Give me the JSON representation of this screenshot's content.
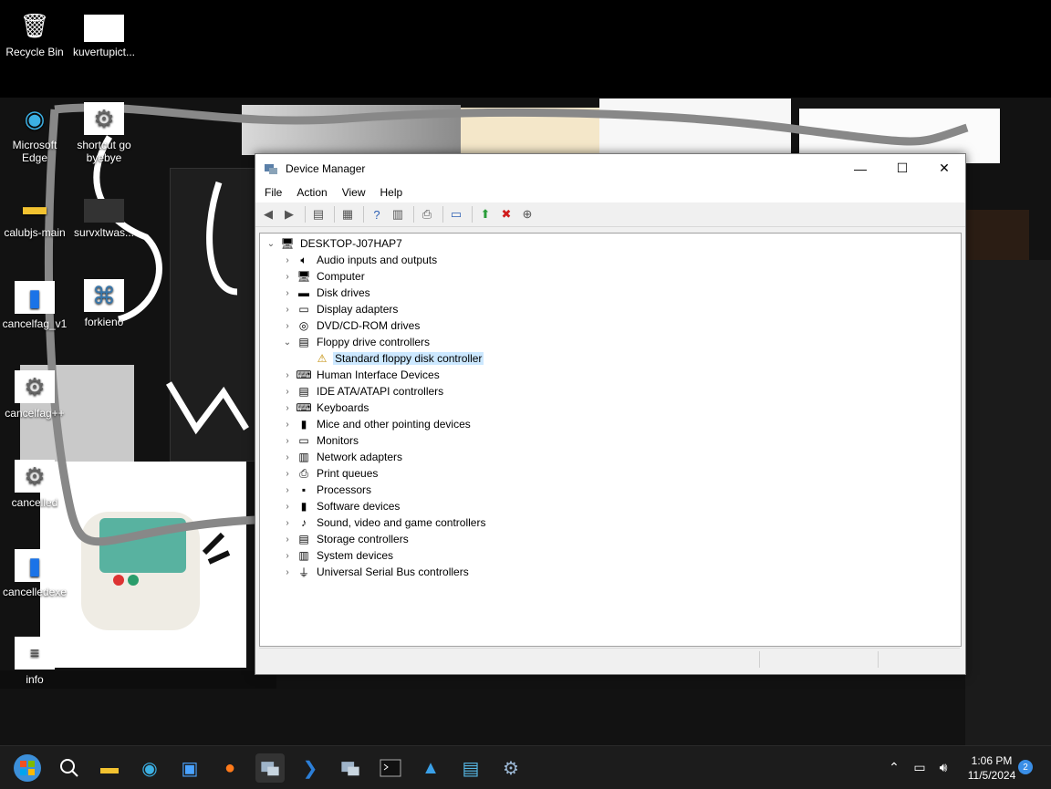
{
  "desktop": {
    "icons": [
      {
        "label": "Recycle Bin",
        "icon": "recycle-bin-icon"
      },
      {
        "label": "kuvertupict...",
        "icon": "image-file-icon"
      },
      {
        "label": "Microsoft Edge",
        "icon": "edge-icon"
      },
      {
        "label": "shortcut go byebye",
        "icon": "settings-gear-icon"
      },
      {
        "label": "calubjs-main",
        "icon": "folder-icon"
      },
      {
        "label": "survxltwas...",
        "icon": "image-file-icon"
      },
      {
        "label": "cancelfag_v1",
        "icon": "document-icon"
      },
      {
        "label": "forkieno",
        "icon": "python-file-icon"
      },
      {
        "label": "cancelfag++",
        "icon": "settings-gear-icon"
      },
      {
        "label": "cancelled",
        "icon": "settings-gear-icon"
      },
      {
        "label": "cancelledexe",
        "icon": "document-icon"
      },
      {
        "label": "info",
        "icon": "text-file-icon"
      }
    ]
  },
  "window": {
    "title": "Device Manager",
    "menu": [
      "File",
      "Action",
      "View",
      "Help"
    ],
    "controls": {
      "minimize": "—",
      "maximize": "☐",
      "close": "✕"
    },
    "tree": {
      "root": "DESKTOP-J07HAP7",
      "categories": [
        {
          "label": "Audio inputs and outputs",
          "icon": "speaker-icon",
          "expanded": false
        },
        {
          "label": "Computer",
          "icon": "computer-icon",
          "expanded": false
        },
        {
          "label": "Disk drives",
          "icon": "disk-drive-icon",
          "expanded": false
        },
        {
          "label": "Display adapters",
          "icon": "display-adapter-icon",
          "expanded": false
        },
        {
          "label": "DVD/CD-ROM drives",
          "icon": "dvd-drive-icon",
          "expanded": false
        },
        {
          "label": "Floppy drive controllers",
          "icon": "floppy-controller-icon",
          "expanded": true,
          "children": [
            {
              "label": "Standard floppy disk controller",
              "icon": "warning-device-icon",
              "selected": true
            }
          ]
        },
        {
          "label": "Human Interface Devices",
          "icon": "hid-icon",
          "expanded": false
        },
        {
          "label": "IDE ATA/ATAPI controllers",
          "icon": "ide-controller-icon",
          "expanded": false
        },
        {
          "label": "Keyboards",
          "icon": "keyboard-icon",
          "expanded": false
        },
        {
          "label": "Mice and other pointing devices",
          "icon": "mouse-icon",
          "expanded": false
        },
        {
          "label": "Monitors",
          "icon": "monitor-icon",
          "expanded": false
        },
        {
          "label": "Network adapters",
          "icon": "network-adapter-icon",
          "expanded": false
        },
        {
          "label": "Print queues",
          "icon": "printer-icon",
          "expanded": false
        },
        {
          "label": "Processors",
          "icon": "processor-icon",
          "expanded": false
        },
        {
          "label": "Software devices",
          "icon": "software-device-icon",
          "expanded": false
        },
        {
          "label": "Sound, video and game controllers",
          "icon": "sound-controller-icon",
          "expanded": false
        },
        {
          "label": "Storage controllers",
          "icon": "storage-controller-icon",
          "expanded": false
        },
        {
          "label": "System devices",
          "icon": "system-device-icon",
          "expanded": false
        },
        {
          "label": "Universal Serial Bus controllers",
          "icon": "usb-icon",
          "expanded": false
        }
      ]
    }
  },
  "taskbar": {
    "items": [
      "start-icon",
      "search-icon",
      "file-explorer-icon",
      "edge-icon",
      "store-icon",
      "firefox-icon",
      "device-manager-icon",
      "powershell-icon",
      "device-manager-icon",
      "terminal-icon",
      "photos-icon",
      "notepad-icon",
      "settings-icon"
    ],
    "time": "1:06 PM",
    "date": "11/5/2024",
    "notification_count": "2"
  },
  "colors": {
    "selection": "#cce8ff",
    "taskbar": "#1c1c1c",
    "accent": "#3a8ee6"
  }
}
